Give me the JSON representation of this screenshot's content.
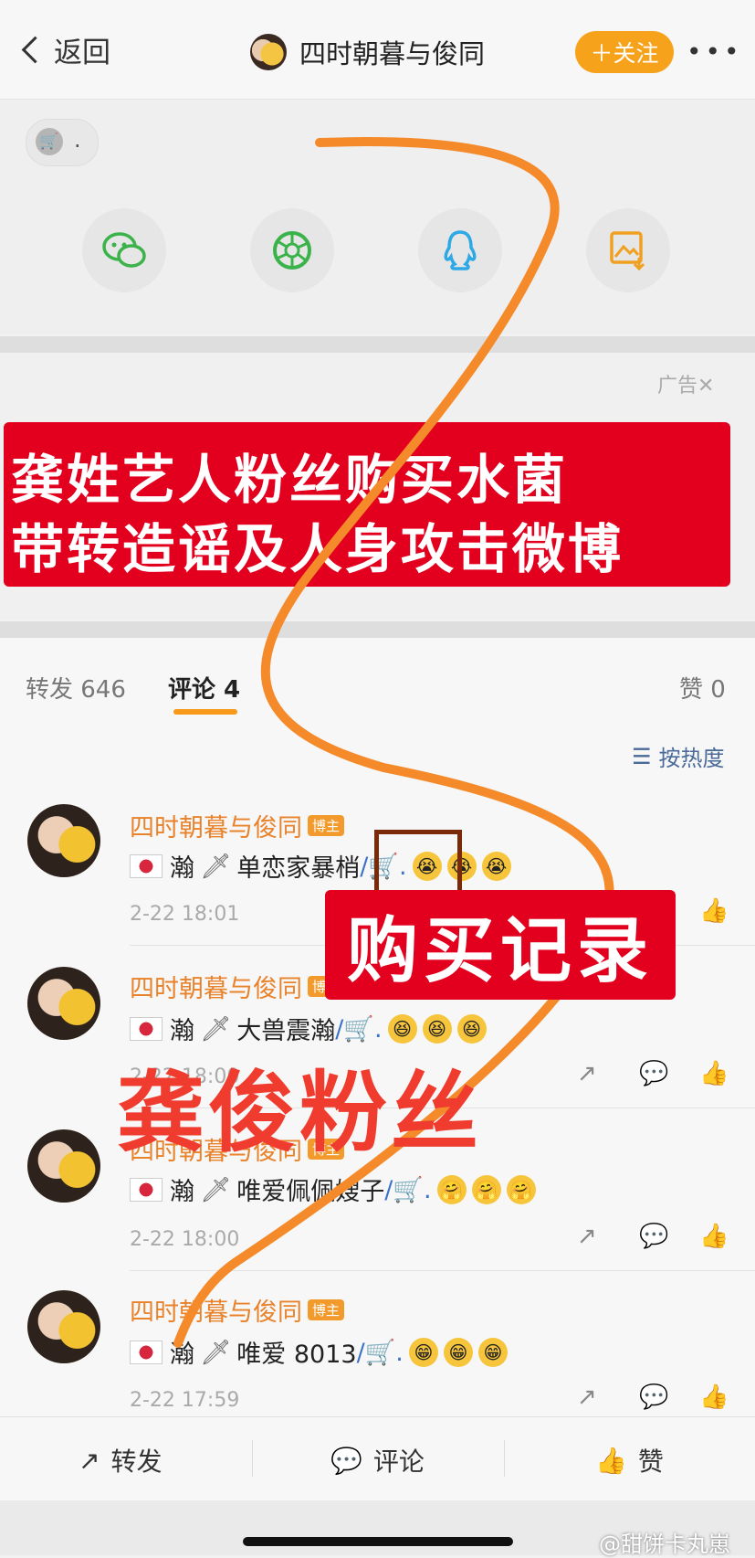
{
  "header": {
    "back_label": "返回",
    "title": "四时朝暮与俊同",
    "follow_label": "＋关注",
    "more": "•••"
  },
  "share": {
    "cart_dot": ".",
    "buttons": [
      "wechat-icon",
      "moments-icon",
      "qq-icon",
      "save-image-icon"
    ],
    "colors": {
      "wechat": "#3bb34a",
      "moments": "#3bb34a",
      "qq": "#2fa9e5",
      "save": "#f0a020"
    }
  },
  "ad": {
    "label": "广告✕",
    "banner_line1": "龚姓艺人粉丝购买水菌",
    "banner_line2": "带转造谣及人身攻击微博",
    "banner_color": "#e3001f"
  },
  "tabs": {
    "repost": "转发 646",
    "comment": "评论 4",
    "like": "赞 0",
    "sort": "按热度",
    "accent": "#f79a1c"
  },
  "comments": [
    {
      "name": "四时朝暮与俊同",
      "badge": "博主",
      "text": "瀚",
      "text_after": "单恋家暴梢",
      "cart": "/🛒.",
      "emoji": [
        "😭",
        "😭",
        "😭"
      ],
      "time": "2-22 18:01"
    },
    {
      "name": "四时朝暮与俊同",
      "badge": "博主",
      "text": "瀚",
      "text_after": "大兽震瀚",
      "cart": "/🛒.",
      "emoji": [
        "😆",
        "😆",
        "😆"
      ],
      "time": "2-22 18:00"
    },
    {
      "name": "四时朝暮与俊同",
      "badge": "博主",
      "text": "瀚",
      "text_after": "唯爱佩佩嫂子",
      "cart": "/🛒.",
      "emoji": [
        "🤗",
        "🤗",
        "🤗"
      ],
      "time": "2-22 18:00"
    },
    {
      "name": "四时朝暮与俊同",
      "badge": "博主",
      "text": "瀚",
      "text_after": "唯爱 8013",
      "cart": "/🛒.",
      "emoji": [
        "😁",
        "😁",
        "😁"
      ],
      "time": "2-22 17:59"
    }
  ],
  "overlays": {
    "purchase_label": "购买记录",
    "fan_label": "龚俊粉丝",
    "line_color": "#f58a2a"
  },
  "bottom": {
    "repost": "转发",
    "comment": "评论",
    "like": "赞"
  },
  "watermark": "@甜饼卡丸崽"
}
